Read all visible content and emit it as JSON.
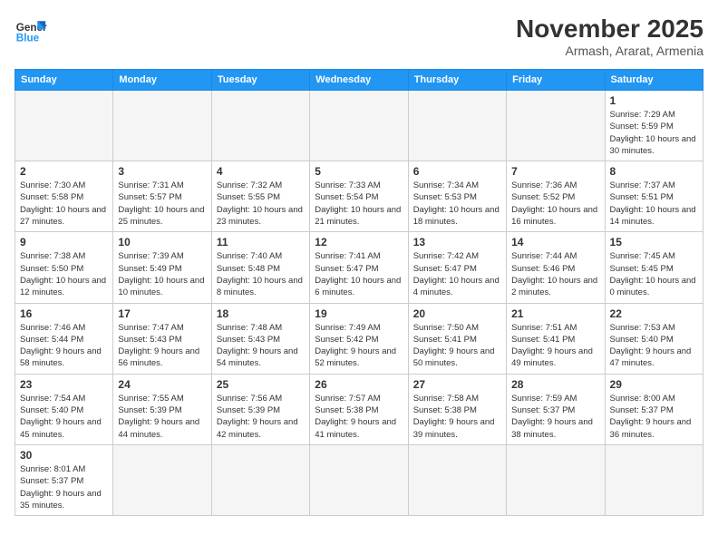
{
  "logo": {
    "text_general": "General",
    "text_blue": "Blue"
  },
  "header": {
    "month": "November 2025",
    "location": "Armash, Ararat, Armenia"
  },
  "weekdays": [
    "Sunday",
    "Monday",
    "Tuesday",
    "Wednesday",
    "Thursday",
    "Friday",
    "Saturday"
  ],
  "weeks": [
    [
      {
        "day": "",
        "info": ""
      },
      {
        "day": "",
        "info": ""
      },
      {
        "day": "",
        "info": ""
      },
      {
        "day": "",
        "info": ""
      },
      {
        "day": "",
        "info": ""
      },
      {
        "day": "",
        "info": ""
      },
      {
        "day": "1",
        "info": "Sunrise: 7:29 AM\nSunset: 5:59 PM\nDaylight: 10 hours and 30 minutes."
      }
    ],
    [
      {
        "day": "2",
        "info": "Sunrise: 7:30 AM\nSunset: 5:58 PM\nDaylight: 10 hours and 27 minutes."
      },
      {
        "day": "3",
        "info": "Sunrise: 7:31 AM\nSunset: 5:57 PM\nDaylight: 10 hours and 25 minutes."
      },
      {
        "day": "4",
        "info": "Sunrise: 7:32 AM\nSunset: 5:55 PM\nDaylight: 10 hours and 23 minutes."
      },
      {
        "day": "5",
        "info": "Sunrise: 7:33 AM\nSunset: 5:54 PM\nDaylight: 10 hours and 21 minutes."
      },
      {
        "day": "6",
        "info": "Sunrise: 7:34 AM\nSunset: 5:53 PM\nDaylight: 10 hours and 18 minutes."
      },
      {
        "day": "7",
        "info": "Sunrise: 7:36 AM\nSunset: 5:52 PM\nDaylight: 10 hours and 16 minutes."
      },
      {
        "day": "8",
        "info": "Sunrise: 7:37 AM\nSunset: 5:51 PM\nDaylight: 10 hours and 14 minutes."
      }
    ],
    [
      {
        "day": "9",
        "info": "Sunrise: 7:38 AM\nSunset: 5:50 PM\nDaylight: 10 hours and 12 minutes."
      },
      {
        "day": "10",
        "info": "Sunrise: 7:39 AM\nSunset: 5:49 PM\nDaylight: 10 hours and 10 minutes."
      },
      {
        "day": "11",
        "info": "Sunrise: 7:40 AM\nSunset: 5:48 PM\nDaylight: 10 hours and 8 minutes."
      },
      {
        "day": "12",
        "info": "Sunrise: 7:41 AM\nSunset: 5:47 PM\nDaylight: 10 hours and 6 minutes."
      },
      {
        "day": "13",
        "info": "Sunrise: 7:42 AM\nSunset: 5:47 PM\nDaylight: 10 hours and 4 minutes."
      },
      {
        "day": "14",
        "info": "Sunrise: 7:44 AM\nSunset: 5:46 PM\nDaylight: 10 hours and 2 minutes."
      },
      {
        "day": "15",
        "info": "Sunrise: 7:45 AM\nSunset: 5:45 PM\nDaylight: 10 hours and 0 minutes."
      }
    ],
    [
      {
        "day": "16",
        "info": "Sunrise: 7:46 AM\nSunset: 5:44 PM\nDaylight: 9 hours and 58 minutes."
      },
      {
        "day": "17",
        "info": "Sunrise: 7:47 AM\nSunset: 5:43 PM\nDaylight: 9 hours and 56 minutes."
      },
      {
        "day": "18",
        "info": "Sunrise: 7:48 AM\nSunset: 5:43 PM\nDaylight: 9 hours and 54 minutes."
      },
      {
        "day": "19",
        "info": "Sunrise: 7:49 AM\nSunset: 5:42 PM\nDaylight: 9 hours and 52 minutes."
      },
      {
        "day": "20",
        "info": "Sunrise: 7:50 AM\nSunset: 5:41 PM\nDaylight: 9 hours and 50 minutes."
      },
      {
        "day": "21",
        "info": "Sunrise: 7:51 AM\nSunset: 5:41 PM\nDaylight: 9 hours and 49 minutes."
      },
      {
        "day": "22",
        "info": "Sunrise: 7:53 AM\nSunset: 5:40 PM\nDaylight: 9 hours and 47 minutes."
      }
    ],
    [
      {
        "day": "23",
        "info": "Sunrise: 7:54 AM\nSunset: 5:40 PM\nDaylight: 9 hours and 45 minutes."
      },
      {
        "day": "24",
        "info": "Sunrise: 7:55 AM\nSunset: 5:39 PM\nDaylight: 9 hours and 44 minutes."
      },
      {
        "day": "25",
        "info": "Sunrise: 7:56 AM\nSunset: 5:39 PM\nDaylight: 9 hours and 42 minutes."
      },
      {
        "day": "26",
        "info": "Sunrise: 7:57 AM\nSunset: 5:38 PM\nDaylight: 9 hours and 41 minutes."
      },
      {
        "day": "27",
        "info": "Sunrise: 7:58 AM\nSunset: 5:38 PM\nDaylight: 9 hours and 39 minutes."
      },
      {
        "day": "28",
        "info": "Sunrise: 7:59 AM\nSunset: 5:37 PM\nDaylight: 9 hours and 38 minutes."
      },
      {
        "day": "29",
        "info": "Sunrise: 8:00 AM\nSunset: 5:37 PM\nDaylight: 9 hours and 36 minutes."
      }
    ],
    [
      {
        "day": "30",
        "info": "Sunrise: 8:01 AM\nSunset: 5:37 PM\nDaylight: 9 hours and 35 minutes."
      },
      {
        "day": "",
        "info": ""
      },
      {
        "day": "",
        "info": ""
      },
      {
        "day": "",
        "info": ""
      },
      {
        "day": "",
        "info": ""
      },
      {
        "day": "",
        "info": ""
      },
      {
        "day": "",
        "info": ""
      }
    ]
  ]
}
